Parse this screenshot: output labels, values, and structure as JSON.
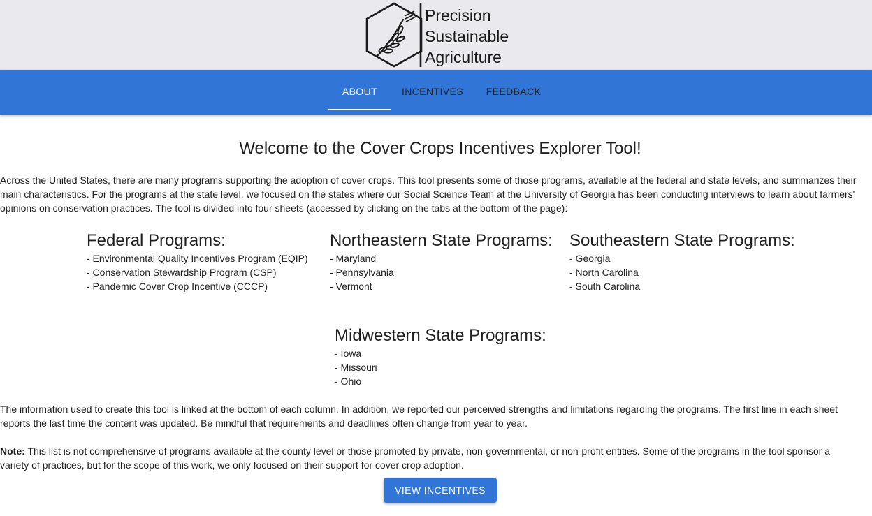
{
  "header": {
    "logo_icon": "hexagon-wheat-icon",
    "brand_lines": [
      "Precision",
      "Sustainable",
      "Agriculture"
    ]
  },
  "nav": {
    "tabs": [
      {
        "label": "ABOUT",
        "active": true
      },
      {
        "label": "INCENTIVES",
        "active": false
      },
      {
        "label": "FEEDBACK",
        "active": false
      }
    ]
  },
  "main": {
    "title": "Welcome to the Cover Crops Incentives Explorer Tool!",
    "intro_lines": [
      "Across the United States, there are many programs supporting the adoption of cover crops. This tool presents some of those programs, available at the federal and state levels, and summarizes their",
      "main characteristics. For the programs at the state level, we focused on the states where our Social Science Team at the University of Georgia has been conducting interviews to learn about farmers'",
      "opinions on conservation practices. The tool is divided into four sheets (accessed by clicking on the tabs at the bottom of the page):"
    ],
    "program_groups": [
      {
        "heading": "Federal Programs:",
        "items": [
          "- Environmental Quality Incentives Program (EQIP)",
          "- Conservation Stewardship Program (CSP)",
          "- Pandemic Cover Crop Incentive (CCCP)"
        ]
      },
      {
        "heading": "Northeastern State Programs:",
        "items": [
          "- Maryland",
          "- Pennsylvania",
          "- Vermont"
        ]
      },
      {
        "heading": "Southeastern State Programs:",
        "items": [
          "- Georgia",
          "- North Carolina",
          "- South Carolina"
        ]
      },
      {
        "heading": "Midwestern State Programs:",
        "items": [
          "- Iowa",
          "- Missouri",
          "- Ohio"
        ]
      }
    ],
    "info_lines": [
      "The information used to create this tool is linked at the bottom of each column. In addition, we reported our perceived strengths and limitations regarding the programs. The first line in each sheet",
      "reports the last time the content was updated. Be mindful that requirements and deadlines often change from year to year."
    ],
    "note": {
      "label": "Note:",
      "text_lines": [
        " This list is not comprehensive of programs available at the county level or those promoted by private, non-governmental, or non-profit entities. Some of the programs in the tool sponsor a",
        "variety of practices, but for the scope of this work, we only focused on their support for cover crop adoption."
      ]
    },
    "cta_label": "VIEW INCENTIVES"
  },
  "colors": {
    "header_bg": "#e9e9ee",
    "nav_bg": "#3176d6",
    "accent": "#3176d6"
  }
}
